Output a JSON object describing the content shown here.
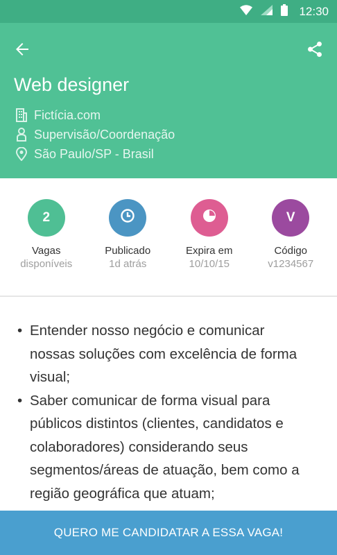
{
  "status_bar": {
    "time": "12:30",
    "icons": [
      "wifi-icon",
      "signal-icon",
      "battery-icon"
    ]
  },
  "colors": {
    "status_bar": "#3fae84",
    "header": "#50c195",
    "cta": "#4a9fcf"
  },
  "header": {
    "title": "Web designer",
    "company": "Fictícia.com",
    "level": "Supervisão/Coordenação",
    "location": "São Paulo/SP - Brasil"
  },
  "stats": [
    {
      "value": "2",
      "label": "Vagas",
      "sub": "disponíveis",
      "color": "#4fbf94",
      "icon": "number"
    },
    {
      "value": "",
      "label": "Publicado",
      "sub": "1d atrás",
      "color": "#4b95c3",
      "icon": "clock-icon"
    },
    {
      "value": "",
      "label": "Expira em",
      "sub": "10/10/15",
      "color": "#de5d92",
      "icon": "pie-icon"
    },
    {
      "value": "V",
      "label": "Código",
      "sub": "v1234567",
      "color": "#9b4a9f",
      "icon": "letter"
    }
  ],
  "description": [
    "Entender nosso negócio e comunicar nossas soluções com excelência de forma visual;",
    "Saber comunicar de forma visual para públicos distintos (clientes, candidatos e colaboradores) considerando seus segmentos/áreas de atuação, bem como a região geográfica que atuam;"
  ],
  "cta_label": "QUERO ME CANDIDATAR A ESSA VAGA!"
}
